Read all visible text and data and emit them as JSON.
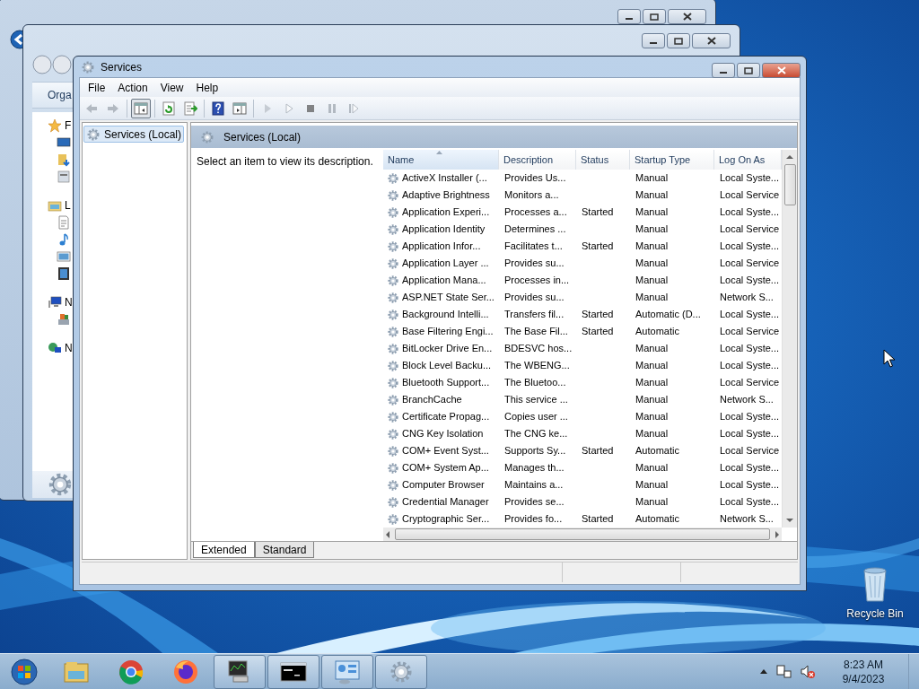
{
  "background_windows": [
    {
      "toolbar_label": "Orga",
      "nav_items": [
        {
          "kind": "star",
          "label": "F"
        },
        {
          "kind": "desktop"
        },
        {
          "kind": "downloads"
        },
        {
          "kind": "recent"
        },
        {
          "kind": "library",
          "label": "L"
        },
        {
          "kind": "document"
        },
        {
          "kind": "music"
        },
        {
          "kind": "pictures"
        },
        {
          "kind": "video"
        },
        {
          "kind": "computer",
          "label": "N"
        },
        {
          "kind": "drive"
        },
        {
          "kind": "network",
          "label": "N"
        }
      ]
    }
  ],
  "window": {
    "title": "Services",
    "menu": [
      "File",
      "Action",
      "View",
      "Help"
    ],
    "toolbar": [
      {
        "kind": "back",
        "disabled": true,
        "pressed": false
      },
      {
        "kind": "forward",
        "disabled": true,
        "pressed": false
      },
      {
        "kind": "tree",
        "disabled": false,
        "pressed": true
      },
      {
        "kind": "refresh",
        "disabled": false,
        "pressed": false
      },
      {
        "kind": "export",
        "disabled": false,
        "pressed": false
      },
      {
        "kind": "help",
        "disabled": false,
        "pressed": false
      },
      {
        "kind": "properties",
        "disabled": false,
        "pressed": false
      },
      {
        "kind": "start",
        "disabled": true,
        "pressed": false
      },
      {
        "kind": "start-params",
        "disabled": true,
        "pressed": false
      },
      {
        "kind": "stop",
        "disabled": true,
        "pressed": false
      },
      {
        "kind": "pause",
        "disabled": true,
        "pressed": false
      },
      {
        "kind": "resume",
        "disabled": true,
        "pressed": false
      }
    ],
    "tree": [
      {
        "label": "Services (Local)",
        "selected": true
      }
    ],
    "pane_title": "Services (Local)",
    "description": "Select an item to view its description.",
    "columns": [
      {
        "label": "Name",
        "sorted": true
      },
      {
        "label": "Description",
        "sorted": false
      },
      {
        "label": "Status",
        "sorted": false
      },
      {
        "label": "Startup Type",
        "sorted": false
      },
      {
        "label": "Log On As",
        "sorted": false
      }
    ],
    "rows": [
      {
        "name": "ActiveX Installer (...",
        "description": "Provides Us...",
        "startup_type": "Manual",
        "log_on_as": "Local Syste..."
      },
      {
        "name": "Adaptive Brightness",
        "description": "Monitors a...",
        "startup_type": "Manual",
        "log_on_as": "Local Service"
      },
      {
        "name": "Application Experi...",
        "description": "Processes a...",
        "status": "Started",
        "startup_type": "Manual",
        "log_on_as": "Local Syste..."
      },
      {
        "name": "Application Identity",
        "description": "Determines ...",
        "startup_type": "Manual",
        "log_on_as": "Local Service"
      },
      {
        "name": "Application Infor...",
        "description": "Facilitates t...",
        "status": "Started",
        "startup_type": "Manual",
        "log_on_as": "Local Syste..."
      },
      {
        "name": "Application Layer ...",
        "description": "Provides su...",
        "startup_type": "Manual",
        "log_on_as": "Local Service"
      },
      {
        "name": "Application Mana...",
        "description": "Processes in...",
        "startup_type": "Manual",
        "log_on_as": "Local Syste..."
      },
      {
        "name": "ASP.NET State Ser...",
        "description": "Provides su...",
        "startup_type": "Manual",
        "log_on_as": "Network S..."
      },
      {
        "name": "Background Intelli...",
        "description": "Transfers fil...",
        "status": "Started",
        "startup_type": "Automatic (D...",
        "log_on_as": "Local Syste..."
      },
      {
        "name": "Base Filtering Engi...",
        "description": "The Base Fil...",
        "status": "Started",
        "startup_type": "Automatic",
        "log_on_as": "Local Service"
      },
      {
        "name": "BitLocker Drive En...",
        "description": "BDESVC hos...",
        "startup_type": "Manual",
        "log_on_as": "Local Syste..."
      },
      {
        "name": "Block Level Backu...",
        "description": "The WBENG...",
        "startup_type": "Manual",
        "log_on_as": "Local Syste..."
      },
      {
        "name": "Bluetooth Support...",
        "description": "The Bluetoo...",
        "startup_type": "Manual",
        "log_on_as": "Local Service"
      },
      {
        "name": "BranchCache",
        "description": "This service ...",
        "startup_type": "Manual",
        "log_on_as": "Network S..."
      },
      {
        "name": "Certificate Propag...",
        "description": "Copies user ...",
        "startup_type": "Manual",
        "log_on_as": "Local Syste..."
      },
      {
        "name": "CNG Key Isolation",
        "description": "The CNG ke...",
        "startup_type": "Manual",
        "log_on_as": "Local Syste..."
      },
      {
        "name": "COM+ Event Syst...",
        "description": "Supports Sy...",
        "status": "Started",
        "startup_type": "Automatic",
        "log_on_as": "Local Service"
      },
      {
        "name": "COM+ System Ap...",
        "description": "Manages th...",
        "startup_type": "Manual",
        "log_on_as": "Local Syste..."
      },
      {
        "name": "Computer Browser",
        "description": "Maintains a...",
        "startup_type": "Manual",
        "log_on_as": "Local Syste..."
      },
      {
        "name": "Credential Manager",
        "description": "Provides se...",
        "startup_type": "Manual",
        "log_on_as": "Local Syste..."
      },
      {
        "name": "Cryptographic Ser...",
        "description": "Provides fo...",
        "status": "Started",
        "startup_type": "Automatic",
        "log_on_as": "Network S..."
      }
    ],
    "view_tabs": [
      {
        "label": "Extended",
        "selected": true
      },
      {
        "label": "Standard",
        "selected": false
      }
    ]
  },
  "desktop_icons": [
    {
      "label": "Recycle Bin"
    }
  ],
  "taskbar": {
    "items": [
      {
        "kind": "start",
        "running": false
      },
      {
        "kind": "explorer",
        "running": false
      },
      {
        "kind": "chrome",
        "running": false
      },
      {
        "kind": "firefox",
        "running": false
      },
      {
        "kind": "monitor",
        "running": true
      },
      {
        "kind": "cmd",
        "running": true
      },
      {
        "kind": "control-panel",
        "running": true
      },
      {
        "kind": "services",
        "running": true
      }
    ],
    "tray": [
      {
        "kind": "show-hidden"
      },
      {
        "kind": "network"
      },
      {
        "kind": "volume-muted"
      }
    ],
    "time": "8:23 AM",
    "date": "9/4/2023"
  }
}
